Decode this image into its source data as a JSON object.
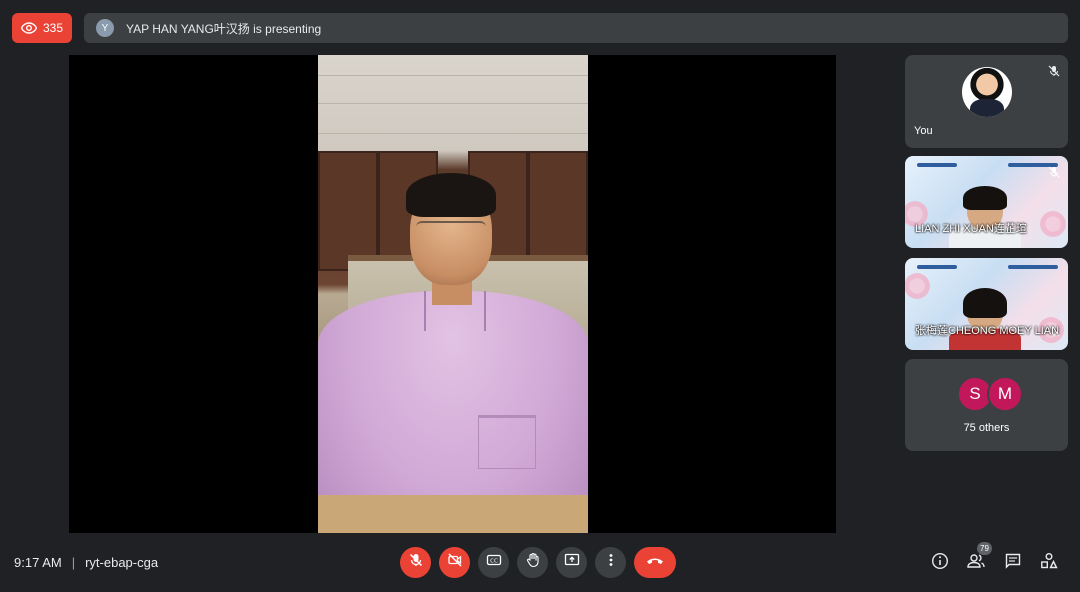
{
  "viewer_badge": {
    "count": "335",
    "icon": "eye-icon",
    "color": "#ea4335"
  },
  "presenting_bar": {
    "avatar_initial": "Y",
    "text": "YAP HAN YANG叶汉扬 is presenting"
  },
  "participants": [
    {
      "name": "You",
      "muted": true
    },
    {
      "name": "LIAN ZHI XUAN连芷瑄",
      "muted": true
    },
    {
      "name": "张梅莲CHEONG MOEY LIAN",
      "muted": true
    }
  ],
  "others": {
    "initials": [
      "S",
      "M"
    ],
    "label": "75 others",
    "avatar_color": "#c2185b"
  },
  "meeting": {
    "time": "9:17 AM",
    "separator": "|",
    "code": "ryt-ebap-cga"
  },
  "controls": {
    "mic": "mic-off-icon",
    "camera": "camera-off-icon",
    "captions": "closed-captions-icon",
    "raise_hand": "raise-hand-icon",
    "present": "present-screen-icon",
    "more": "more-options-icon",
    "hangup": "hang-up-icon"
  },
  "right_controls": {
    "info": "info-icon",
    "people": "people-icon",
    "people_count": "79",
    "chat": "chat-icon",
    "activities": "activities-icon"
  },
  "colors": {
    "background": "#202124",
    "surface": "#3c4043",
    "danger": "#ea4335"
  }
}
